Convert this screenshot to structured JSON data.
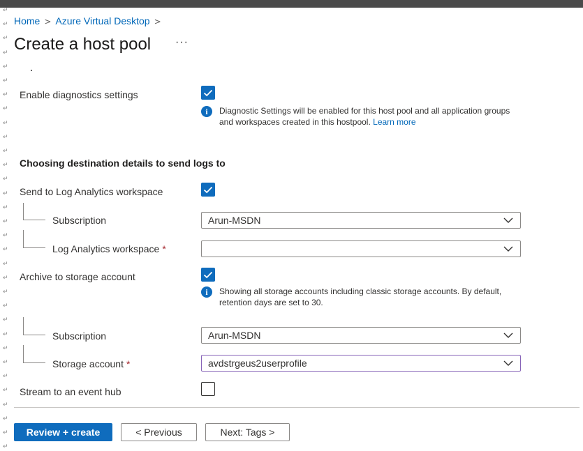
{
  "breadcrumb": {
    "home": "Home",
    "separator": ">",
    "service": "Azure Virtual Desktop",
    "trailing": ">"
  },
  "page": {
    "title": "Create a host pool",
    "more": "···"
  },
  "diagnostics": {
    "enable_label": "Enable diagnostics settings",
    "enable_checked": true,
    "info_text": "Diagnostic Settings will be enabled for this host pool and all application groups and workspaces created in this hostpool.",
    "learn_more": "Learn more"
  },
  "destination": {
    "heading": "Choosing destination details to send logs to",
    "log_analytics": {
      "label": "Send to Log Analytics workspace",
      "checked": true,
      "subscription_label": "Subscription",
      "subscription_value": "Arun-MSDN",
      "workspace_label": "Log Analytics workspace",
      "workspace_value": "",
      "required_mark": "*"
    },
    "storage": {
      "label": "Archive to storage account",
      "checked": true,
      "info_text": "Showing all storage accounts including classic storage accounts. By default, retention days are set to 30.",
      "subscription_label": "Subscription",
      "subscription_value": "Arun-MSDN",
      "account_label": "Storage account",
      "account_value": "avdstrgeus2userprofile",
      "required_mark": "*"
    },
    "event_hub": {
      "label": "Stream to an event hub",
      "checked": false
    }
  },
  "footer": {
    "review_create": "Review + create",
    "previous": "< Previous",
    "next": "Next: Tags >"
  },
  "colors": {
    "accent": "#0f6cbd",
    "link": "#0067b8",
    "required": "#a4262c"
  },
  "icons": {
    "check": "checkmark-icon",
    "info": "info-icon",
    "dropdown": "chevron-down-icon"
  }
}
